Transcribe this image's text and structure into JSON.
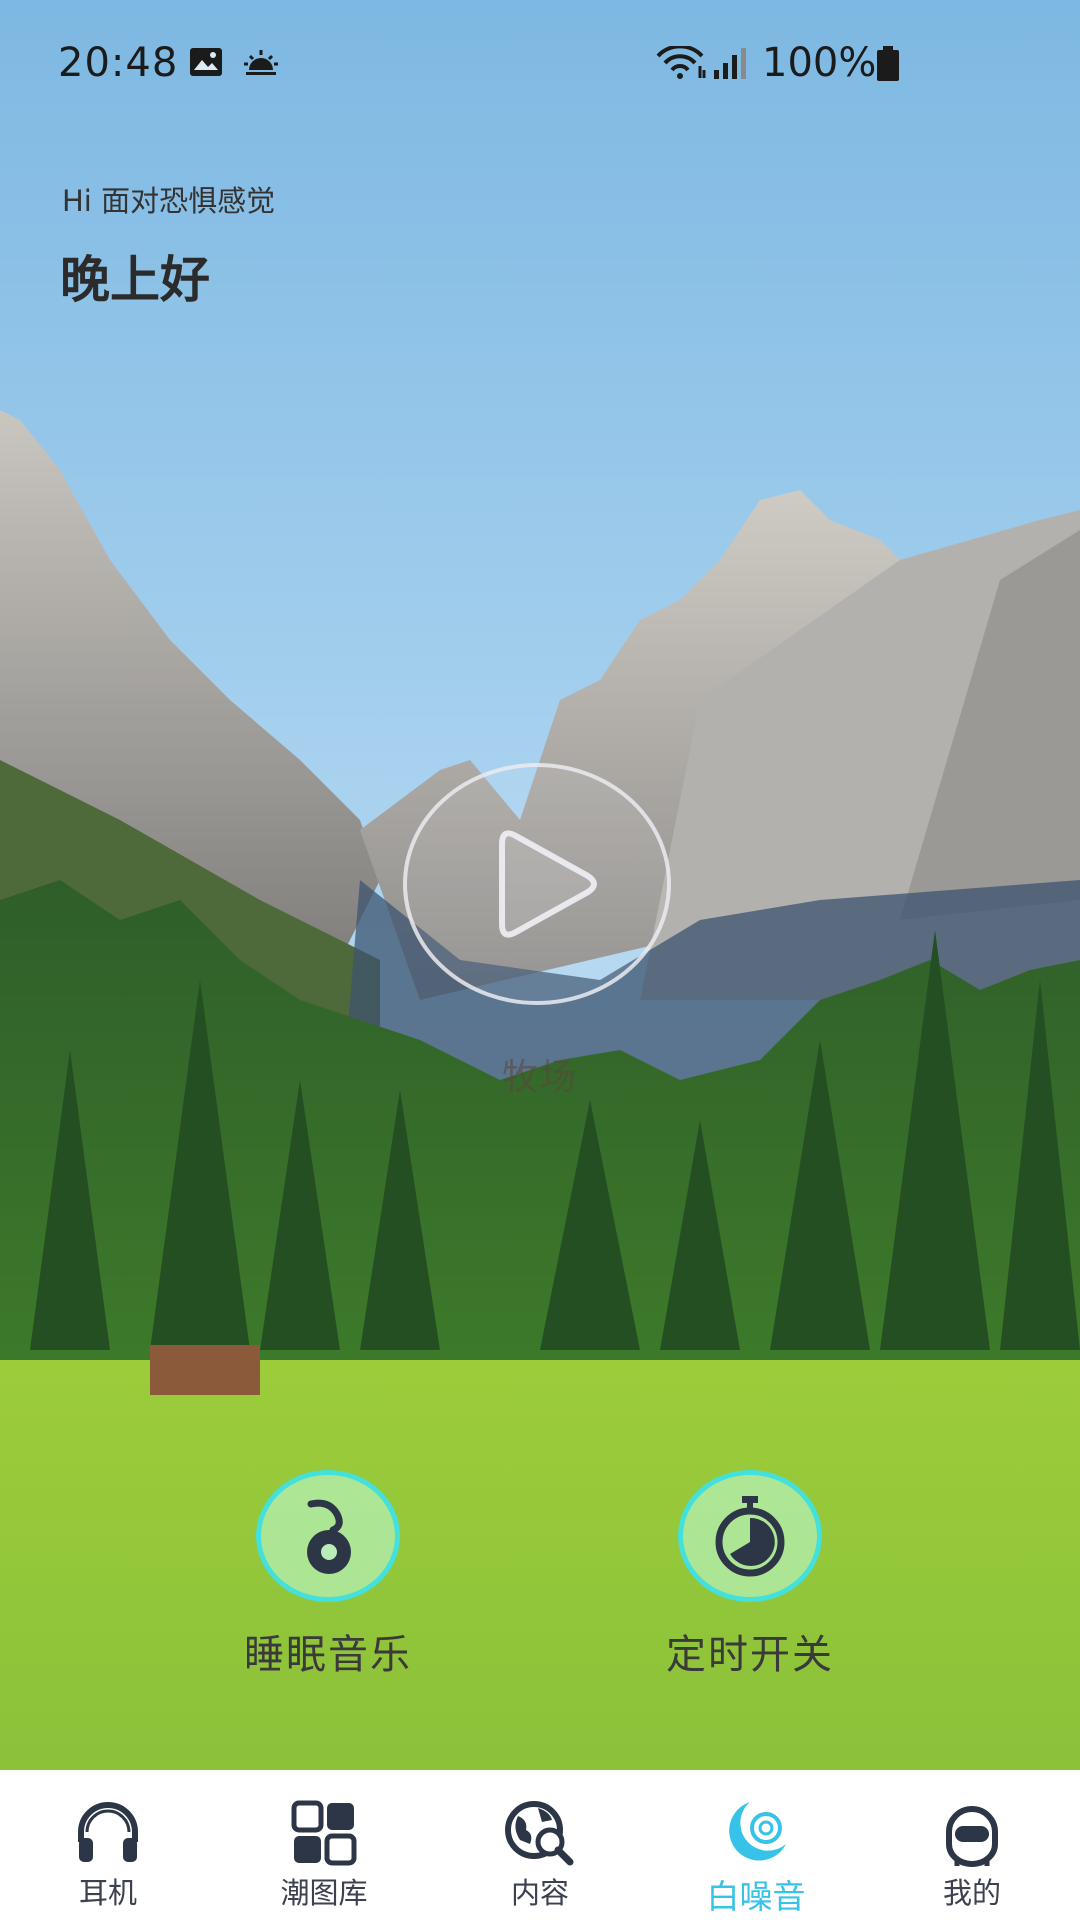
{
  "status": {
    "time": "20:48",
    "battery": "100%"
  },
  "greeting": {
    "subtitle": "Hi 面对恐惧感觉",
    "title": "晚上好"
  },
  "player": {
    "caption": "牧场"
  },
  "actions": [
    {
      "label": "睡眠音乐",
      "icon": "music-note-icon"
    },
    {
      "label": "定时开关",
      "icon": "timer-icon"
    }
  ],
  "nav": {
    "items": [
      {
        "label": "耳机",
        "icon": "headphones-icon"
      },
      {
        "label": "潮图库",
        "icon": "gallery-grid-icon"
      },
      {
        "label": "内容",
        "icon": "globe-search-icon"
      },
      {
        "label": "白噪音",
        "icon": "white-noise-icon",
        "active": true
      },
      {
        "label": "我的",
        "icon": "robot-avatar-icon"
      }
    ]
  },
  "colors": {
    "accent": "#37c3e8",
    "ring": "#44e0dc",
    "navText": "#3c4050"
  }
}
